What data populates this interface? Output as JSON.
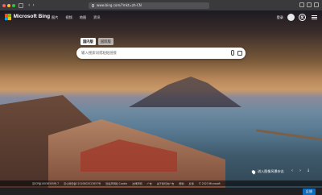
{
  "browser": {
    "url": "www.bing.com/?mkt=zh-CN"
  },
  "header": {
    "logo_text": "Microsoft Bing",
    "nav": [
      "图片",
      "视频",
      "地图",
      "资讯"
    ],
    "login_label": "登录",
    "reward_label": "奖"
  },
  "search": {
    "tabs": [
      "国内版",
      "国际版"
    ],
    "active_tab": 0,
    "placeholder": "输入搜索词或粘贴链接"
  },
  "caption": {
    "text": "进入图像风景杂志"
  },
  "footer": {
    "links": [
      "京ICP备10036305号-7",
      "京公网安备11010802022657号",
      "隐私声明和 Cookie",
      "法律声明",
      "广告",
      "关于我们的广告",
      "帮助",
      "反馈",
      "© 2023 Microsoft"
    ]
  },
  "feedback_button": "反馈",
  "colors": {
    "ms_red": "#f25022",
    "ms_green": "#7fba00",
    "ms_blue": "#00a4ef",
    "ms_yellow": "#ffb900",
    "accent_blue": "#0f6cbd"
  }
}
